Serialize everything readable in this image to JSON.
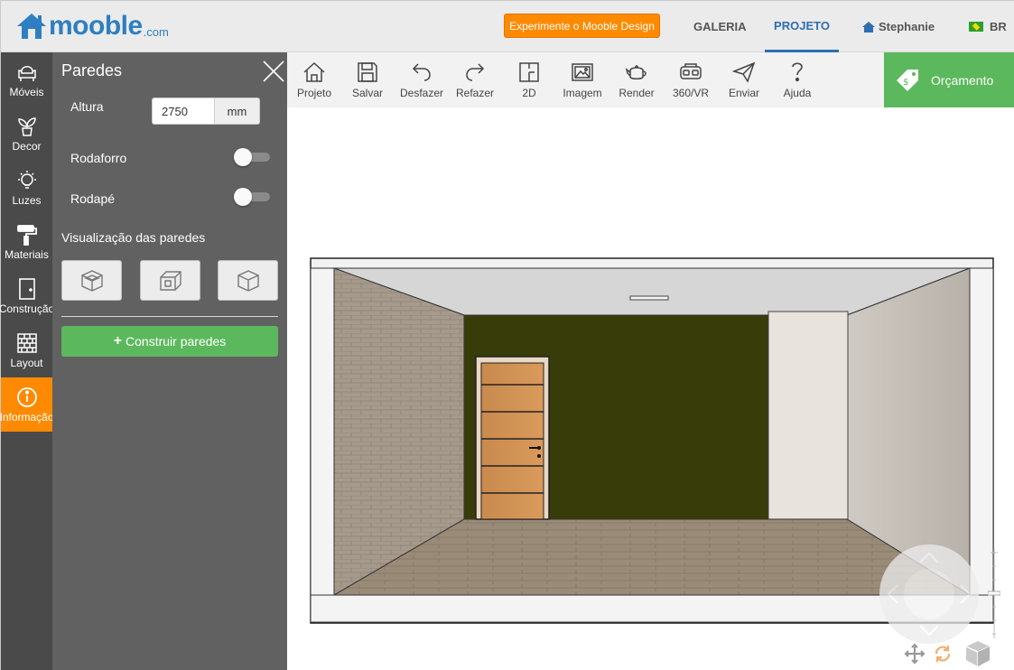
{
  "brand": {
    "name": "mooble",
    "suffix": ".com",
    "color": "#2d7fc1"
  },
  "header": {
    "cta_label": "Experimente o Mooble Design",
    "nav": {
      "galeria": "GALERIA",
      "projeto": "PROJETO",
      "user": "Stephanie",
      "lang": "BR"
    },
    "active_tab": "PROJETO"
  },
  "rail": {
    "items": [
      {
        "label": "Móveis",
        "icon": "armchair-icon"
      },
      {
        "label": "Decor",
        "icon": "plant-icon"
      },
      {
        "label": "Luzes",
        "icon": "lightbulb-icon"
      },
      {
        "label": "Materiais",
        "icon": "paint-roller-icon"
      },
      {
        "label": "Construção",
        "icon": "door-icon"
      },
      {
        "label": "Layout",
        "icon": "brick-wall-icon"
      },
      {
        "label": "Informação",
        "icon": "info-icon"
      }
    ],
    "active": "Informação",
    "active_color": "#ff8a00"
  },
  "panel": {
    "title": "Paredes",
    "height_label": "Altura",
    "height_value": "2750",
    "height_unit": "mm",
    "rodaforro_label": "Rodaforro",
    "rodaforro_on": false,
    "rodape_label": "Rodapé",
    "rodape_on": false,
    "visualization_label": "Visualização das paredes",
    "visualization_options": [
      "walls-full-icon",
      "walls-cut-icon",
      "walls-hidden-icon"
    ],
    "build_label": "Construir paredes",
    "build_icon": "plus-icon"
  },
  "toolbar": {
    "tools": [
      {
        "label": "Projeto",
        "icon": "home-icon"
      },
      {
        "label": "Salvar",
        "icon": "floppy-icon"
      },
      {
        "label": "Desfazer",
        "icon": "undo-icon"
      },
      {
        "label": "Refazer",
        "icon": "redo-icon"
      },
      {
        "label": "2D",
        "icon": "floorplan-icon"
      },
      {
        "label": "Imagem",
        "icon": "image-icon"
      },
      {
        "label": "Render",
        "icon": "teapot-icon"
      },
      {
        "label": "360/VR",
        "icon": "vr-headset-icon"
      },
      {
        "label": "Enviar",
        "icon": "paper-plane-icon"
      },
      {
        "label": "Ajuda",
        "icon": "question-icon"
      }
    ],
    "budget_label": "Orçamento",
    "budget_icon": "price-tag-icon",
    "budget_color": "#5cb85c"
  },
  "scene": {
    "back_wall_color": "#383c08",
    "left_wall": "brick",
    "floor": "wood",
    "door": "wooden-door"
  },
  "controls": [
    "move-icon",
    "rotate-icon",
    "cube-view-icon"
  ]
}
